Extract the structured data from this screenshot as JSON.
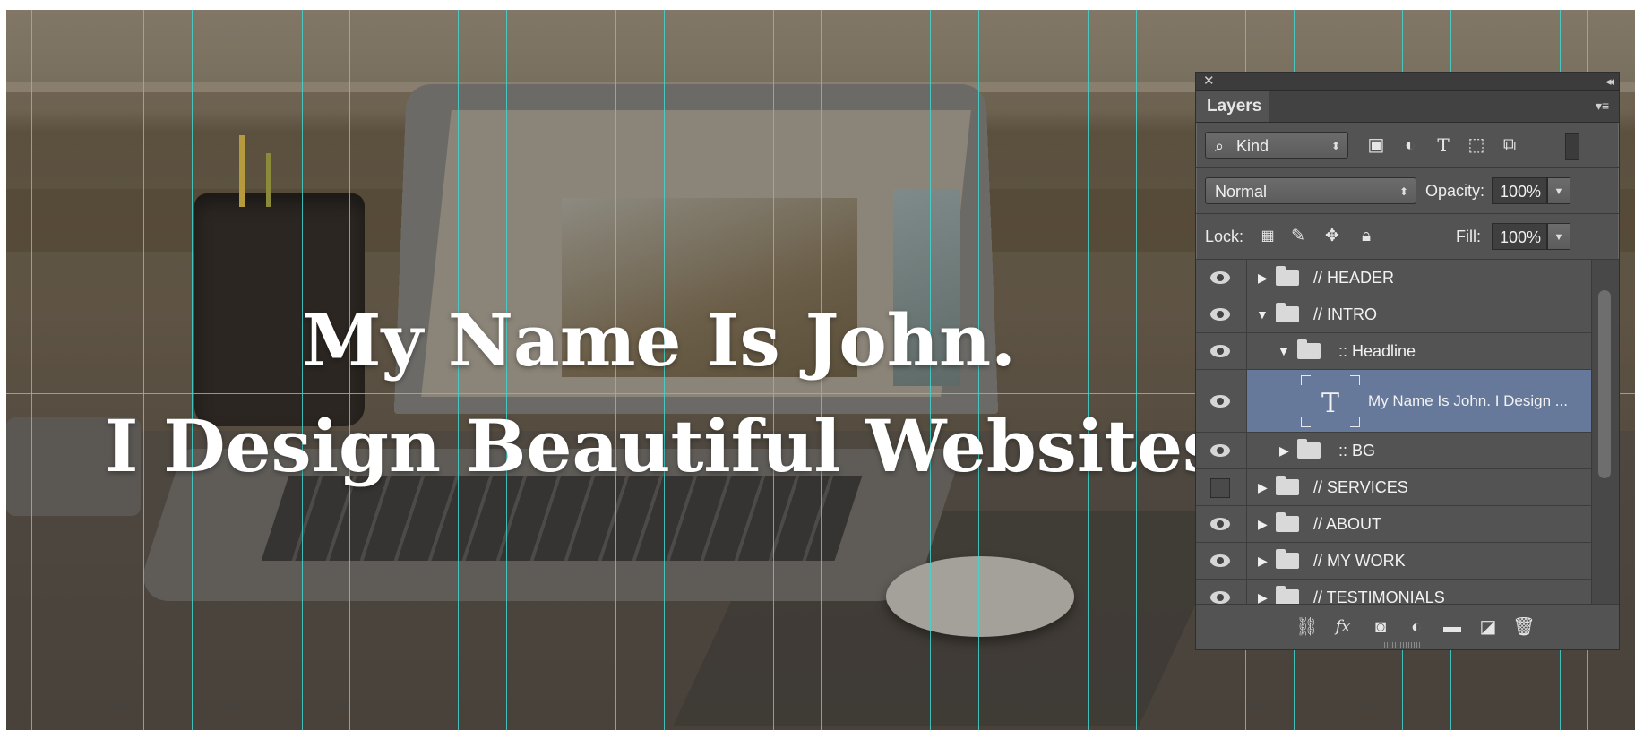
{
  "canvas": {
    "headline_line1": "My Name Is John.",
    "headline_line2": "I Design Beautiful Websites."
  },
  "layers_panel": {
    "close_icon": "close-icon",
    "collapse_icon": "double-chevron-left-icon",
    "tab_label": "Layers",
    "menu_icon": "panel-menu-icon",
    "filter": {
      "kind_label": "Kind",
      "icons": [
        "image-filter-icon",
        "adjustment-filter-icon",
        "type-filter-icon",
        "shape-filter-icon",
        "smart-object-filter-icon"
      ]
    },
    "blend_mode": "Normal",
    "opacity_label": "Opacity:",
    "opacity_value": "100%",
    "lock_label": "Lock:",
    "lock_icons": [
      "lock-transparent-icon",
      "lock-paint-icon",
      "lock-move-icon",
      "lock-all-icon"
    ],
    "fill_label": "Fill:",
    "fill_value": "100%",
    "layers": [
      {
        "name": "// HEADER",
        "visible": true,
        "type": "group",
        "expanded": false,
        "depth": 0
      },
      {
        "name": "// INTRO",
        "visible": true,
        "type": "group",
        "expanded": true,
        "depth": 0
      },
      {
        "name": ":: Headline",
        "visible": true,
        "type": "group",
        "expanded": true,
        "depth": 1
      },
      {
        "name": "My Name Is John. I Design ...",
        "visible": true,
        "type": "text",
        "selected": true,
        "depth": 2
      },
      {
        "name": ":: BG",
        "visible": true,
        "type": "group",
        "expanded": false,
        "depth": 1
      },
      {
        "name": "// SERVICES",
        "visible": false,
        "type": "group",
        "expanded": false,
        "depth": 0
      },
      {
        "name": "// ABOUT",
        "visible": true,
        "type": "group",
        "expanded": false,
        "depth": 0
      },
      {
        "name": "// MY WORK",
        "visible": true,
        "type": "group",
        "expanded": false,
        "depth": 0
      },
      {
        "name": "// TESTIMONIALS",
        "visible": true,
        "type": "group",
        "expanded": false,
        "depth": 0
      }
    ],
    "bottom_icons": [
      "link-layers-icon",
      "fx-icon",
      "add-mask-icon",
      "adjustment-layer-icon",
      "new-group-icon",
      "new-layer-icon",
      "trash-icon"
    ],
    "colors": {
      "panel_bg": "#535353",
      "selected_row": "#67799a",
      "guide": "#3fd6d0"
    }
  }
}
